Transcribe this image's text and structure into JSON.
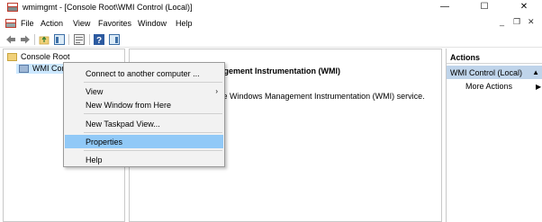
{
  "window": {
    "title": "wmimgmt - [Console Root\\WMI Control (Local)]",
    "controls": {
      "minimize": "—",
      "maximize": "☐",
      "close": "✕"
    }
  },
  "menubar": {
    "items": [
      "File",
      "Action",
      "View",
      "Favorites",
      "Window",
      "Help"
    ],
    "mdi": {
      "minimize": "_",
      "restore": "❐",
      "close": "✕"
    }
  },
  "toolbar": {
    "buttons": [
      "back-icon",
      "forward-icon",
      "up-folder-icon",
      "show-hide-tree-icon",
      "properties-icon",
      "help-icon",
      "show-hide-action-pane-icon"
    ]
  },
  "tree": {
    "items": [
      {
        "label": "Console Root",
        "icon": "folder-icon"
      },
      {
        "label": "WMI Cont",
        "icon": "wmi-control-icon"
      }
    ]
  },
  "result": {
    "heading": "anagement Instrumentation (WMI)",
    "description": "the Windows Management Instrumentation (WMI) service."
  },
  "actions": {
    "header": "Actions",
    "section": "WMI Control (Local)",
    "more_actions": "More Actions"
  },
  "context_menu": {
    "items": [
      {
        "label": "Connect to another computer ..."
      },
      {
        "label": "View",
        "submenu": true
      },
      {
        "label": "New Window from Here"
      },
      {
        "label": "New Taskpad View..."
      },
      {
        "label": "Properties",
        "highlighted": true
      },
      {
        "label": "Help"
      }
    ]
  },
  "colors": {
    "selection": "#91c9f7",
    "actions_section_bg": "#bfd4ea",
    "tree_selection": "#cce8ff"
  }
}
